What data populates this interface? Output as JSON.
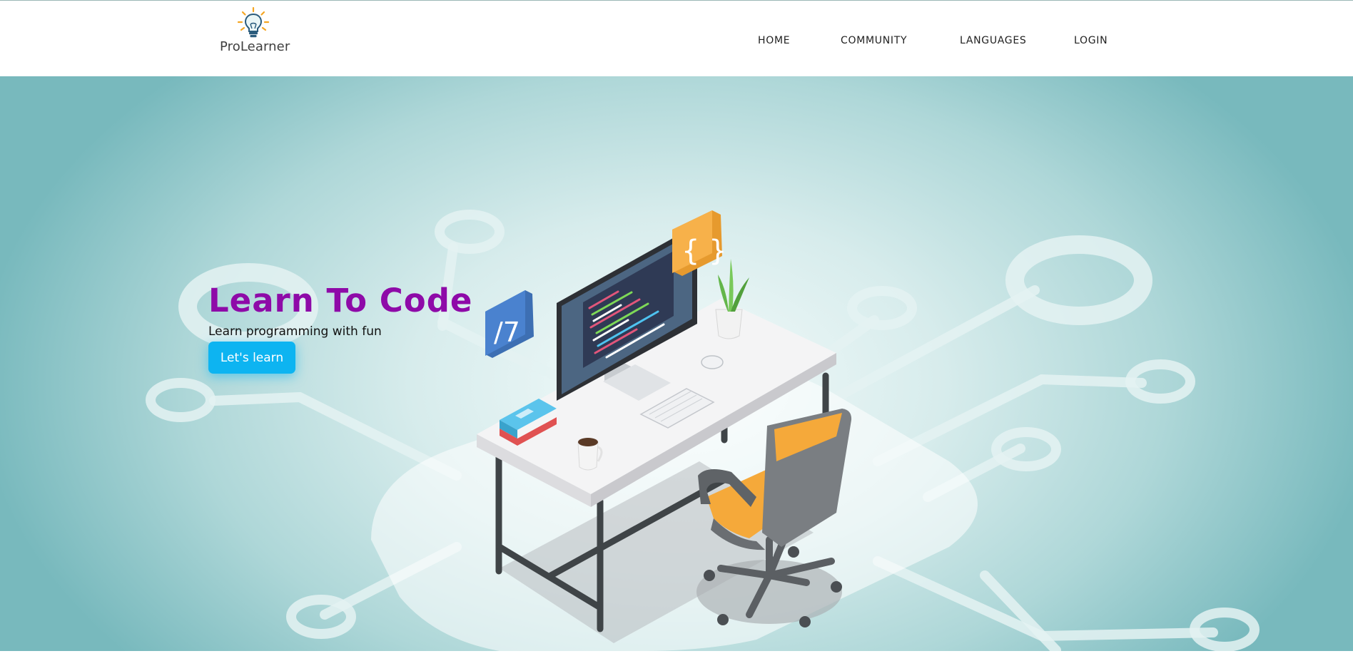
{
  "brand": {
    "name": "ProLearner",
    "icon": "lightbulb-icon"
  },
  "nav": {
    "items": [
      {
        "label": "HOME"
      },
      {
        "label": "COMMUNITY"
      },
      {
        "label": "LANGUAGES"
      },
      {
        "label": "LOGIN"
      }
    ]
  },
  "hero": {
    "title": "Learn To Code",
    "subtitle": "Learn programming with fun",
    "cta_label": "Let's learn",
    "illustration": "isometric-desk-workstation",
    "badges": {
      "left_symbol": "/7",
      "right_symbol": "{ }"
    }
  },
  "colors": {
    "title": "#8e0aa8",
    "cta": "#0db4f1",
    "hero_bg": "#aed7d8",
    "badge_blue": "#4a7fc7",
    "badge_orange": "#f7b14a",
    "chair_seat": "#f5a93a"
  }
}
